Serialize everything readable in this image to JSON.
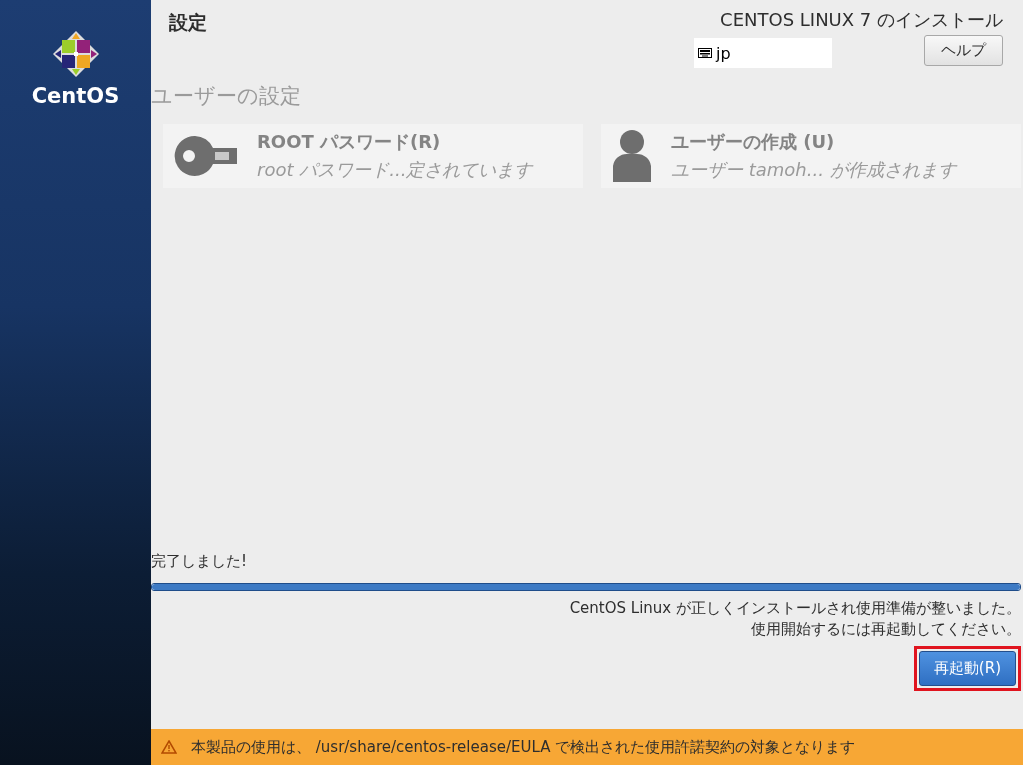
{
  "sidebar": {
    "logo_text": "CentOS"
  },
  "header": {
    "title": "設定",
    "install_title": "CENTOS LINUX 7 のインストール",
    "keyboard_layout": "jp",
    "help_button": "ヘルプ"
  },
  "section": {
    "title": "ユーザーの設定"
  },
  "spokes": [
    {
      "kind": "key",
      "title": "ROOT パスワード(R)",
      "status": "root パスワード...定されています"
    },
    {
      "kind": "user",
      "title": "ユーザーの作成 (U)",
      "status": "ユーザー  tamoh... が作成されます"
    }
  ],
  "progress": {
    "status": "完了しました!",
    "level": 1
  },
  "messages": [
    "CentOS Linux が正しくインストールされ使用準備が整いました。",
    "使用開始するには再起動してください。"
  ],
  "reboot_button": {
    "label": "再起動(R)",
    "highlighted": true
  },
  "warning_bar": {
    "text": "本製品の使用は、  /usr/share/centos-release/EULA で検出された使用許諾契約の対象となります"
  }
}
